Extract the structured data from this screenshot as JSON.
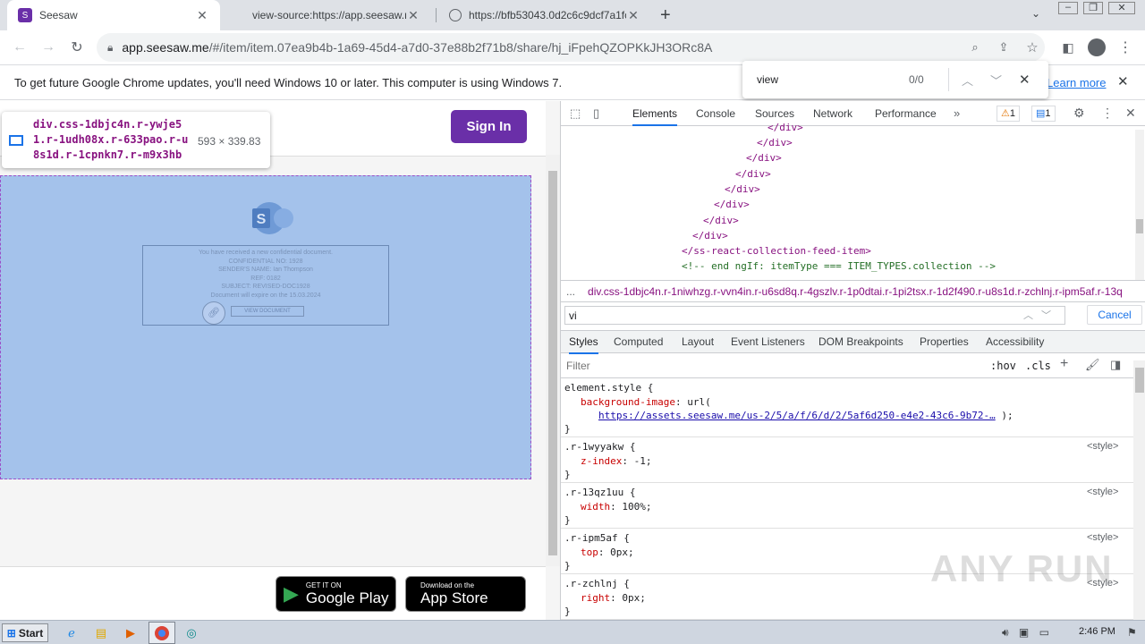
{
  "tabs": [
    {
      "label": "Seesaw",
      "close": "✕"
    },
    {
      "label": "view-source:https://app.seesaw.me",
      "close": "✕"
    },
    {
      "label": "https://bfb53043.0d2c6c9dcf7a1fc6",
      "close": "✕"
    }
  ],
  "toolbar": {
    "url_host": "app.seesaw.me",
    "url_path": "/#/item/item.07ea9b4b-1a69-45d4-a7d0-37e88b2f71b8/share/hj_iFpehQZOPKkJH3ORc8A"
  },
  "infobar": {
    "message": "To get future Google Chrome updates, you'll need Windows 10 or later. This computer is using Windows 7.",
    "link": "Learn more"
  },
  "findbar": {
    "query": "view",
    "count": "0/0"
  },
  "page": {
    "signin": "Sign In",
    "tooltip": {
      "selector": "div.css-1dbjc4n.r-ywje51.r-1udh08x.r-633pao.r-u8s1d.r-1cpnkn7.r-m9x3hb",
      "size": "593 × 339.83"
    },
    "doc_lines": [
      "You have received a new confidential document.",
      "CONFIDENTIAL NO: 1928",
      "SENDER'S NAME: Ian Thompson",
      "REF: 0182",
      "SUBJECT: REVISED-DOC1928",
      "Document will expire on the 15.03.2024"
    ],
    "view_doc": "VIEW DOCUMENT",
    "google_play": {
      "small": "GET IT ON",
      "big": "Google Play"
    },
    "app_store": {
      "small": "Download on the",
      "big": "App Store"
    }
  },
  "devtools": {
    "tabs": [
      "Elements",
      "Console",
      "Sources",
      "Network",
      "Performance"
    ],
    "warnings": "1",
    "messages": "1",
    "dom_lines": [
      "</div>",
      "</div>",
      "</div>",
      "</div>",
      "</div>",
      "</div>",
      "</div>",
      "</div>",
      "</ss-react-collection-feed-item>",
      "<!-- end ngIf: itemType === ITEM_TYPES.collection -->"
    ],
    "breadcrumb": "div.css-1dbjc4n.r-1niwhzg.r-vvn4in.r-u6sd8q.r-4gszlv.r-1p0dtai.r-1pi2tsx.r-1d2f490.r-u8s1d.r-zchlnj.r-ipm5af.r-13q",
    "search": "vi",
    "cancel": "Cancel",
    "sub_tabs": [
      "Styles",
      "Computed",
      "Layout",
      "Event Listeners",
      "DOM Breakpoints",
      "Properties",
      "Accessibility"
    ],
    "filter_placeholder": "Filter",
    "hov": ":hov",
    "cls": ".cls",
    "rules": [
      {
        "selector": "element.style {",
        "prop": "background-image",
        "value": "url(",
        "link": "https://assets.seesaw.me/us-2/5/a/f/6/d/2/5af6d250-e4e2-43c6-9b72-…",
        "tail": ");"
      },
      {
        "selector": ".r-1wyyakw {",
        "prop": "z-index",
        "value": "-1;",
        "source": "<style>"
      },
      {
        "selector": ".r-13qz1uu {",
        "prop": "width",
        "value": "100%;",
        "source": "<style>"
      },
      {
        "selector": ".r-ipm5af {",
        "prop": "top",
        "value": "0px;",
        "source": "<style>"
      },
      {
        "selector": ".r-zchlnj {",
        "prop": "right",
        "value": "0px;",
        "source": "<style>"
      }
    ]
  },
  "taskbar": {
    "start": "Start",
    "time": "2:46 PM"
  },
  "watermark": "ANY RUN"
}
